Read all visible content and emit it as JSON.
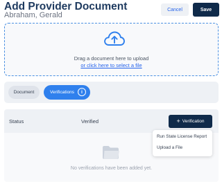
{
  "header": {
    "title": "Add Provider Document",
    "subtitle": "Abraham, Gerald",
    "cancel_label": "Cancel",
    "save_label": "Save"
  },
  "upload": {
    "drag_text": "Drag a document here to upload",
    "link_text": "or click here to select a file",
    "icon": "cloud-upload-icon"
  },
  "tabs": [
    {
      "label": "Document",
      "active": false
    },
    {
      "label": "Verifications",
      "active": true,
      "icon": "info-icon"
    }
  ],
  "verifications": {
    "columns": [
      "Status",
      "Verified"
    ],
    "add_button_label": "Verification",
    "add_button_icon": "plus-icon",
    "menu_items": [
      "Run State License Report",
      "Upload a File"
    ],
    "empty_icon": "folder-icon",
    "empty_text": "No verifications have been added yet."
  },
  "colors": {
    "primary_dark": "#0f2a4a",
    "accent_blue": "#2f80ed",
    "link_blue": "#2563eb"
  }
}
